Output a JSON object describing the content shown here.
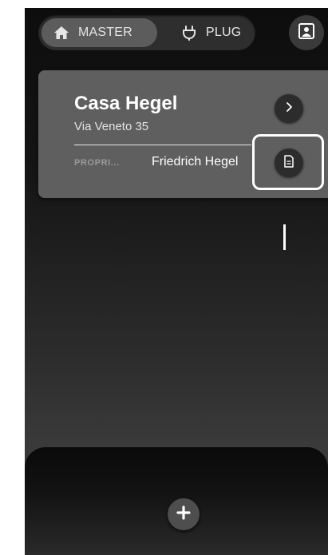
{
  "tabs": {
    "master_label": "MASTER",
    "plug_label": "PLUG"
  },
  "property": {
    "name": "Casa Hegel",
    "address": "Via Veneto 35",
    "owner_label": "PROPRI...",
    "owner_name": "Friedrich Hegel"
  },
  "icons": {
    "master_tab": "home-icon",
    "plug_tab": "plug-icon",
    "profile": "profile-card-icon",
    "open_property": "chevron-right-icon",
    "documents": "document-icon",
    "add": "plus-icon"
  }
}
